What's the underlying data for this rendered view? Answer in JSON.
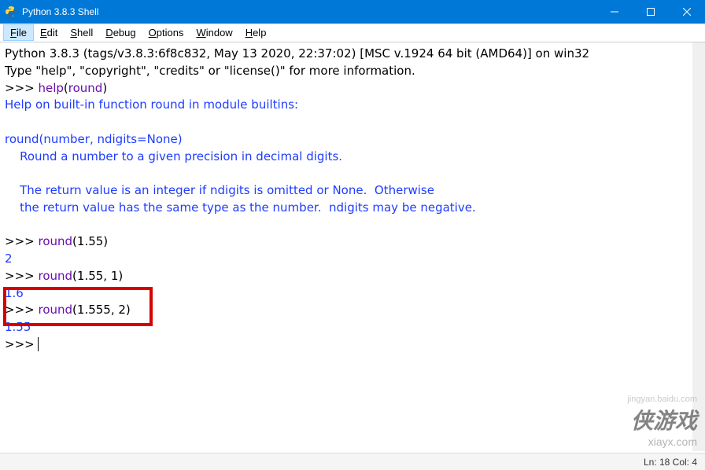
{
  "window": {
    "title": "Python 3.8.3 Shell"
  },
  "menu": {
    "file": "File",
    "edit": "Edit",
    "shell": "Shell",
    "debug": "Debug",
    "options": "Options",
    "window": "Window",
    "help": "Help"
  },
  "shell": {
    "banner1": "Python 3.8.3 (tags/v3.8.3:6f8c832, May 13 2020, 22:37:02) [MSC v.1924 64 bit (AMD64)] on win32",
    "banner2": "Type \"help\", \"copyright\", \"credits\" or \"license()\" for more information.",
    "prompt": ">>> ",
    "help_call_fn": "help",
    "help_call_arg": "round",
    "doc1": "Help on built-in function round in module builtins:",
    "doc2": "round(number, ndigits=None)",
    "doc3": "    Round a number to a given precision in decimal digits.",
    "doc4": "    The return value is an integer if ndigits is omitted or None.  Otherwise",
    "doc5": "    the return value has the same type as the number.  ndigits may be negative.",
    "call1_fn": "round",
    "call1_args": "(1.55)",
    "result1": "2",
    "call2_fn": "round",
    "call2_args": "(1.55, 1)",
    "result2": "1.6",
    "call3_fn": "round",
    "call3_args": "(1.555, 2)",
    "result3": "1.55"
  },
  "status": {
    "text": "Ln: 18  Col: 4"
  },
  "watermark": {
    "main": "侠游戏",
    "sub": "xiayx.com",
    "small": "jingyan.baidu.com"
  }
}
